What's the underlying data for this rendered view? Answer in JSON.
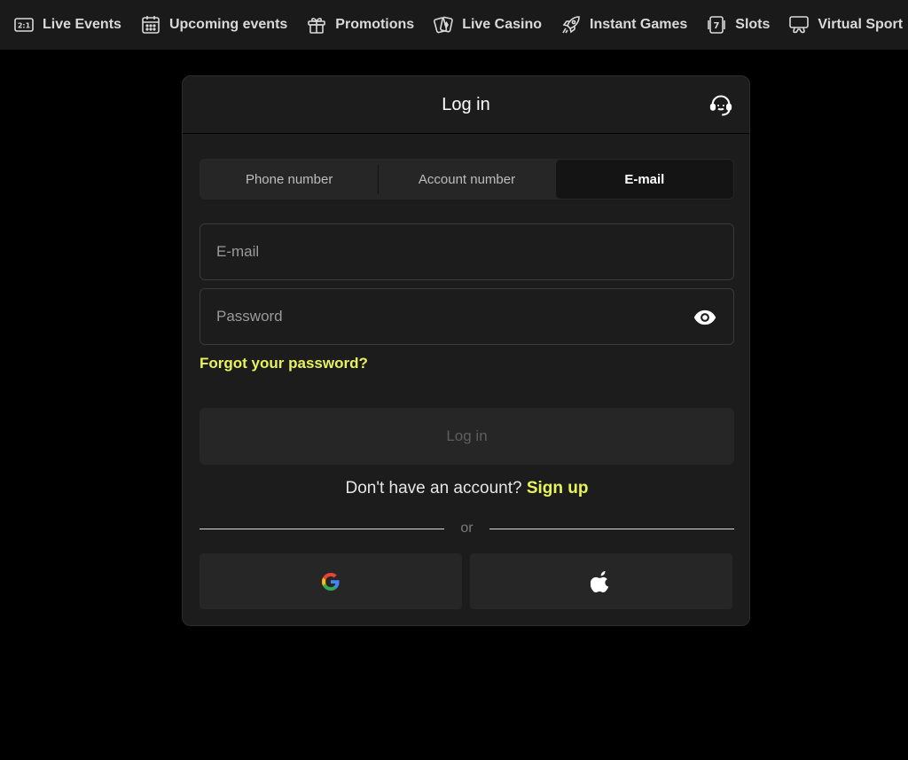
{
  "nav": {
    "items": [
      {
        "label": "Live Events",
        "icon": "score-icon"
      },
      {
        "label": "Upcoming events",
        "icon": "calendar-icon"
      },
      {
        "label": "Promotions",
        "icon": "gift-icon"
      },
      {
        "label": "Live Casino",
        "icon": "cards-icon"
      },
      {
        "label": "Instant Games",
        "icon": "rocket-icon"
      },
      {
        "label": "Slots",
        "icon": "slot-seven-icon"
      },
      {
        "label": "Virtual Sport",
        "icon": "gamepad-icon"
      }
    ],
    "score_glyph": "2:1",
    "slot_glyph": "7"
  },
  "modal": {
    "title": "Log in",
    "support_icon": "headset-icon",
    "tabs": [
      {
        "label": "Phone number",
        "active": false
      },
      {
        "label": "Account number",
        "active": false
      },
      {
        "label": "E-mail",
        "active": true
      }
    ],
    "email": {
      "placeholder": "E-mail",
      "value": ""
    },
    "password": {
      "placeholder": "Password",
      "value": "",
      "toggle_icon": "eye-icon"
    },
    "forgot_label": "Forgot your password?",
    "login_label": "Log in",
    "signup_prompt": "Don't have an account?",
    "signup_label": "Sign up",
    "or_label": "or",
    "social": [
      {
        "provider": "google",
        "icon": "google-icon"
      },
      {
        "provider": "apple",
        "icon": "apple-icon"
      }
    ]
  },
  "colors": {
    "accent": "#e8f25c",
    "background": "#000000",
    "nav_bg": "#1a1a1a",
    "modal_bg": "#1c1c1c",
    "control_bg": "#262626"
  }
}
